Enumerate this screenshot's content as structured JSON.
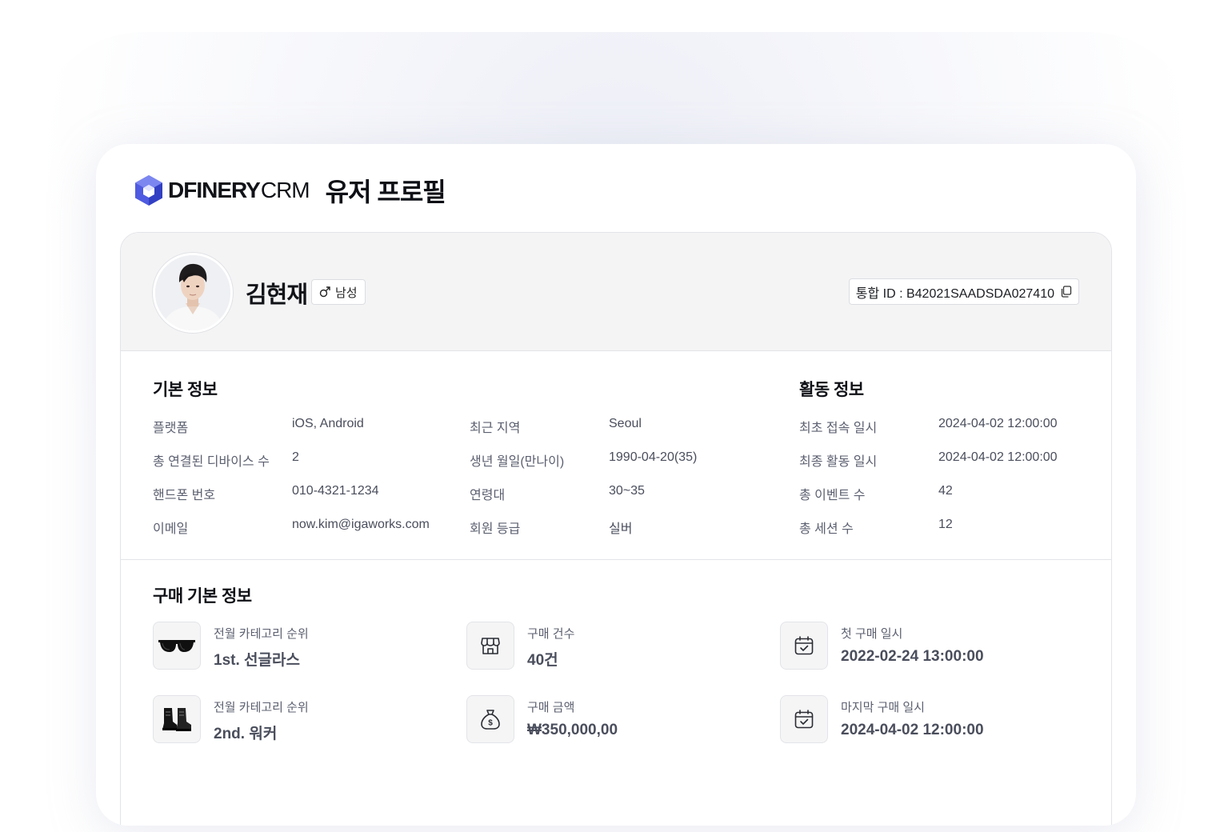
{
  "brand": {
    "logo_main": "DFINERY",
    "logo_suffix": "CRM",
    "accent": "#4f5be0"
  },
  "page": {
    "title": "유저 프로필"
  },
  "profile": {
    "name": "김현재",
    "gender": "남성",
    "uid_label": "통합 ID : B42021SAADSDA027410"
  },
  "basic_info": {
    "title": "기본 정보",
    "rows": [
      {
        "label": "플랫폼",
        "value": "iOS, Android"
      },
      {
        "label": "총 연결된 디바이스 수",
        "value": "2"
      },
      {
        "label": "핸드폰 번호",
        "value": "010-4321-1234"
      },
      {
        "label": "이메일",
        "value": "now.kim@igaworks.com"
      },
      {
        "label": "최근 지역",
        "value": "Seoul"
      },
      {
        "label": "생년 월일(만나이)",
        "value": "1990-04-20(35)"
      },
      {
        "label": "연령대",
        "value": "30~35"
      },
      {
        "label": "회원 등급",
        "value": "실버"
      }
    ]
  },
  "activity_info": {
    "title": "활동 정보",
    "rows": [
      {
        "label": "최초 접속 일시",
        "value": "2024-04-02 12:00:00"
      },
      {
        "label": "최종 활동 일시",
        "value": "2024-04-02 12:00:00"
      },
      {
        "label": "총 이벤트 수",
        "value": "42"
      },
      {
        "label": "총 세션 수",
        "value": "12"
      }
    ]
  },
  "purchase_info": {
    "title": "구매 기본 정보",
    "items": [
      {
        "icon": "sunglasses-icon",
        "label": "전월 카테고리 순위",
        "value": "1st. 선글라스"
      },
      {
        "icon": "store-icon",
        "label": "구매 건수",
        "value": "40건"
      },
      {
        "icon": "calendar-check-icon",
        "label": "첫 구매 일시",
        "value": "2022-02-24 13:00:00"
      },
      {
        "icon": "boots-icon",
        "label": "전월 카테고리 순위",
        "value": "2nd. 워커"
      },
      {
        "icon": "money-bag-icon",
        "label": "구매 금액",
        "value": "₩350,000,00"
      },
      {
        "icon": "calendar-check-icon",
        "label": "마지막 구매 일시",
        "value": "2024-04-02 12:00:00"
      }
    ]
  }
}
